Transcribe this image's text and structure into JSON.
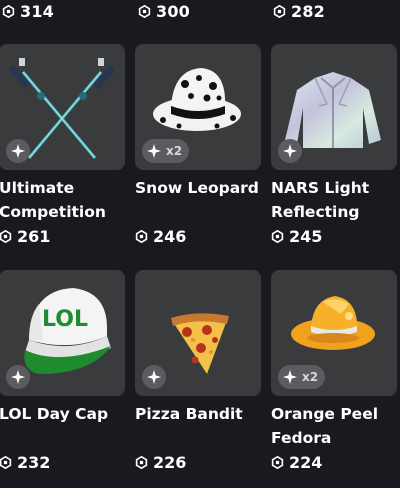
{
  "top_prices": [
    "314",
    "300",
    "282"
  ],
  "items": [
    {
      "name": "Ultimate Competition",
      "price": "261",
      "count": ""
    },
    {
      "name": "Snow Leopard",
      "price": "246",
      "count": "x2"
    },
    {
      "name": "NARS Light Reflecting",
      "price": "245",
      "count": ""
    },
    {
      "name": "LOL Day Cap",
      "price": "232",
      "count": ""
    },
    {
      "name": "Pizza Bandit",
      "price": "226",
      "count": ""
    },
    {
      "name": "Orange Peel Fedora",
      "price": "224",
      "count": "x2"
    }
  ],
  "icons": {
    "currency": "robux-icon",
    "badge": "limited-sparkle-icon"
  },
  "colors": {
    "background": "#191a1f",
    "card": "#393b3d",
    "badge": "#5a5c5f",
    "text": "#ffffff"
  }
}
